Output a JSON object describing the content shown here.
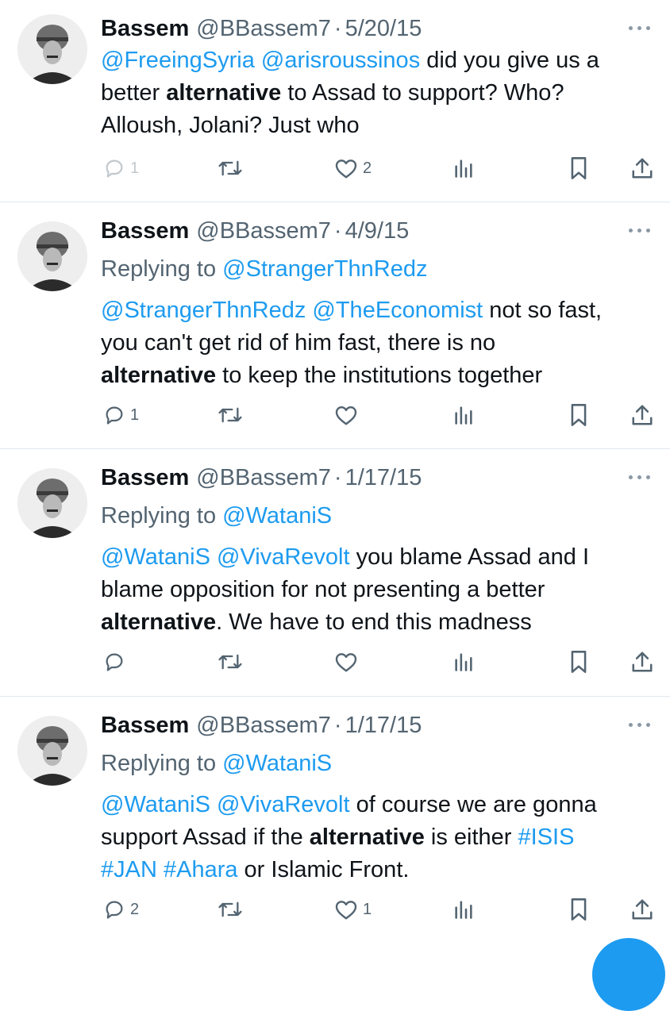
{
  "tweets": [
    {
      "name": "Bassem",
      "handle": "@BBassem7",
      "separator": "·",
      "date": "5/20/15",
      "replying_prefix": "",
      "replying_to": "",
      "body": [
        [
          {
            "t": "@FreeingSyria",
            "s": "link"
          },
          {
            "t": " ",
            "s": ""
          },
          {
            "t": "@arisroussinos",
            "s": "link"
          },
          {
            "t": " did you give us a",
            "s": ""
          }
        ],
        [
          {
            "t": "better ",
            "s": ""
          },
          {
            "t": "alternative",
            "s": "b"
          },
          {
            "t": " to Assad to support? Who?",
            "s": ""
          }
        ],
        [
          {
            "t": "Alloush, Jolani? Just who",
            "s": ""
          }
        ]
      ],
      "reply_count": "1",
      "retweet_count": "",
      "like_count": "2"
    },
    {
      "name": "Bassem",
      "handle": "@BBassem7",
      "separator": "·",
      "date": "4/9/15",
      "replying_prefix": "Replying to ",
      "replying_to": "@StrangerThnRedz",
      "body": [
        [
          {
            "t": "@StrangerThnRedz",
            "s": "link"
          },
          {
            "t": " ",
            "s": ""
          },
          {
            "t": "@TheEconomist",
            "s": "link"
          },
          {
            "t": " not so fast,",
            "s": ""
          }
        ],
        [
          {
            "t": "you can't get rid of him fast, there is no",
            "s": ""
          }
        ],
        [
          {
            "t": "alternative",
            "s": "b"
          },
          {
            "t": " to keep the institutions together",
            "s": ""
          }
        ]
      ],
      "reply_count": "1",
      "retweet_count": "",
      "like_count": ""
    },
    {
      "name": "Bassem",
      "handle": "@BBassem7",
      "separator": "·",
      "date": "1/17/15",
      "replying_prefix": "Replying to ",
      "replying_to": "@WataniS",
      "body": [
        [
          {
            "t": "@WataniS",
            "s": "link"
          },
          {
            "t": " ",
            "s": ""
          },
          {
            "t": "@VivaRevolt",
            "s": "link"
          },
          {
            "t": " you blame Assad and I",
            "s": ""
          }
        ],
        [
          {
            "t": "blame opposition for not presenting a better",
            "s": ""
          }
        ],
        [
          {
            "t": "alternative",
            "s": "b"
          },
          {
            "t": ". We have to end this madness",
            "s": ""
          }
        ]
      ],
      "reply_count": "",
      "retweet_count": "",
      "like_count": ""
    },
    {
      "name": "Bassem",
      "handle": "@BBassem7",
      "separator": "·",
      "date": "1/17/15",
      "replying_prefix": "Replying to ",
      "replying_to": "@WataniS",
      "body": [
        [
          {
            "t": "@WataniS",
            "s": "link"
          },
          {
            "t": " ",
            "s": ""
          },
          {
            "t": "@VivaRevolt",
            "s": "link"
          },
          {
            "t": " of course we are gonna",
            "s": ""
          }
        ],
        [
          {
            "t": "support Assad if the ",
            "s": ""
          },
          {
            "t": "alternative",
            "s": "b"
          },
          {
            "t": " is either ",
            "s": ""
          },
          {
            "t": "#ISIS",
            "s": "link"
          }
        ],
        [
          {
            "t": "#JAN",
            "s": "link"
          },
          {
            "t": " ",
            "s": ""
          },
          {
            "t": "#Ahara",
            "s": "link"
          },
          {
            "t": " or Islamic Front.",
            "s": ""
          }
        ]
      ],
      "reply_count": "2",
      "retweet_count": "",
      "like_count": "1"
    }
  ],
  "icons": {
    "reply": "reply-icon",
    "retweet": "retweet-icon",
    "like": "like-icon",
    "views": "views-icon",
    "bookmark": "bookmark-icon",
    "share": "share-icon",
    "more": "more-icon",
    "compose": "compose-icon"
  },
  "colors": {
    "link": "#1d9bf0",
    "secondary_text": "#536471",
    "divider": "#e1e8ed"
  }
}
